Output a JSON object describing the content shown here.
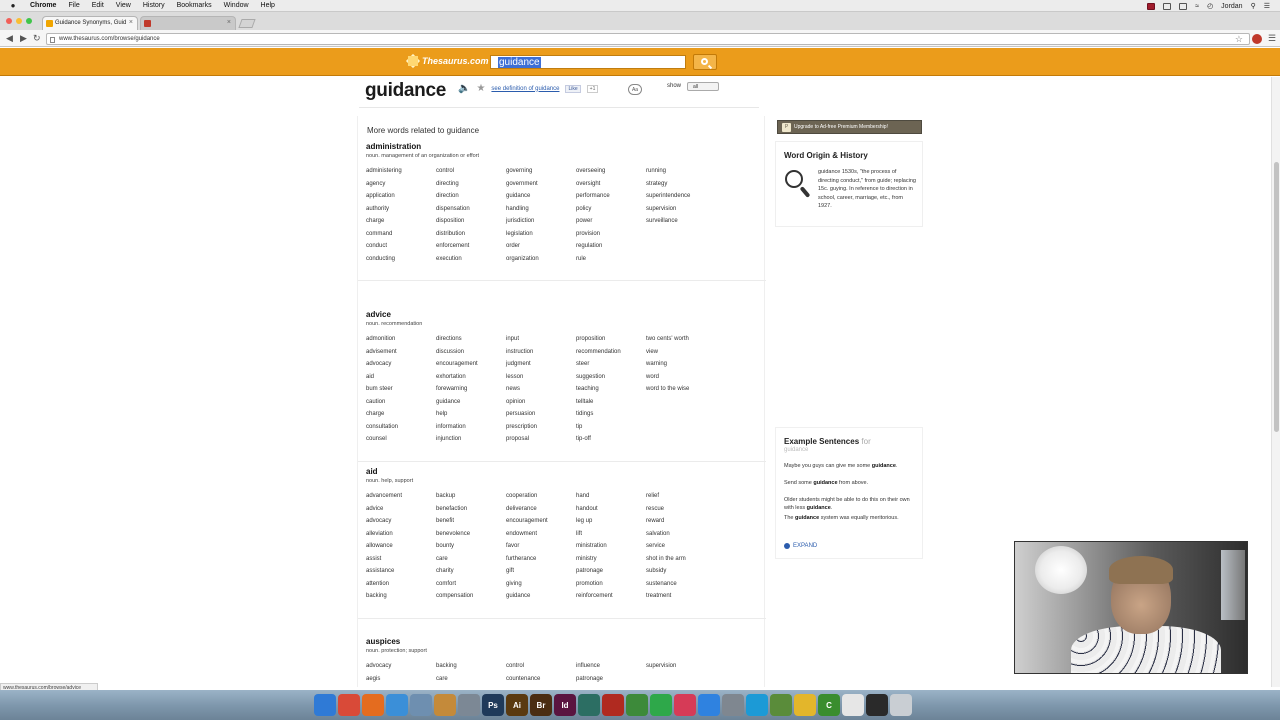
{
  "menubar": {
    "apple": "",
    "items": [
      "Chrome",
      "File",
      "Edit",
      "View",
      "History",
      "Bookmarks",
      "Window",
      "Help"
    ],
    "user": "Jordan"
  },
  "tabs": [
    {
      "title": "Guidance Synonyms, Guid",
      "active": true,
      "favicon_color": "#f0a500"
    },
    {
      "title": "",
      "active": false,
      "favicon_color": "#c0392b"
    }
  ],
  "address": {
    "url": "www.thesaurus.com/browse/guidance"
  },
  "site": {
    "logo": "Thesaurus.com",
    "search_value": "guidance"
  },
  "entry": {
    "headword": "guidance",
    "see_definition": "see definition of guidance",
    "like": "Like",
    "gplus": "+1",
    "aa": "Aa",
    "show_label": "show",
    "show_value": "all",
    "related_heading": "More words related to guidance"
  },
  "sections": [
    {
      "title": "administration",
      "definition": "noun. management of an organization or effort",
      "columns": [
        [
          "administering",
          "agency",
          "application",
          "authority",
          "charge",
          "command",
          "conduct",
          "conducting"
        ],
        [
          "control",
          "directing",
          "direction",
          "dispensation",
          "disposition",
          "distribution",
          "enforcement",
          "execution"
        ],
        [
          "governing",
          "government",
          "guidance",
          "handling",
          "jurisdiction",
          "legislation",
          "order",
          "organization"
        ],
        [
          "overseeing",
          "oversight",
          "performance",
          "policy",
          "power",
          "provision",
          "regulation",
          "rule"
        ],
        [
          "running",
          "strategy",
          "superintendence",
          "supervision",
          "surveillance"
        ]
      ]
    },
    {
      "title": "advice",
      "definition": "noun. recommendation",
      "columns": [
        [
          "admonition",
          "advisement",
          "advocacy",
          "aid",
          "bum steer",
          "caution",
          "charge",
          "consultation",
          "counsel"
        ],
        [
          "directions",
          "discussion",
          "encouragement",
          "exhortation",
          "forewarning",
          "guidance",
          "help",
          "information",
          "injunction"
        ],
        [
          "input",
          "instruction",
          "judgment",
          "lesson",
          "news",
          "opinion",
          "persuasion",
          "prescription",
          "proposal"
        ],
        [
          "proposition",
          "recommendation",
          "steer",
          "suggestion",
          "teaching",
          "telltale",
          "tidings",
          "tip",
          "tip-off"
        ],
        [
          "two cents' worth",
          "view",
          "warning",
          "word",
          "word to the wise"
        ]
      ]
    },
    {
      "title": "aid",
      "definition": "noun. help, support",
      "columns": [
        [
          "advancement",
          "advice",
          "advocacy",
          "alleviation",
          "allowance",
          "assist",
          "assistance",
          "attention",
          "backing"
        ],
        [
          "backup",
          "benefaction",
          "benefit",
          "benevolence",
          "bounty",
          "care",
          "charity",
          "comfort",
          "compensation"
        ],
        [
          "cooperation",
          "deliverance",
          "encouragement",
          "endowment",
          "favor",
          "furtherance",
          "gift",
          "giving",
          "guidance"
        ],
        [
          "hand",
          "handout",
          "leg up",
          "lift",
          "ministration",
          "ministry",
          "patronage",
          "promotion",
          "reinforcement"
        ],
        [
          "relief",
          "rescue",
          "reward",
          "salvation",
          "service",
          "shot in the arm",
          "subsidy",
          "sustenance",
          "treatment"
        ]
      ]
    },
    {
      "title": "auspices",
      "definition": "noun. protection; support",
      "columns": [
        [
          "advocacy",
          "aegis"
        ],
        [
          "backing",
          "care"
        ],
        [
          "control",
          "countenance"
        ],
        [
          "influence",
          "patronage"
        ],
        [
          "supervision"
        ]
      ]
    }
  ],
  "sidebar": {
    "upgrade": "Upgrade to Ad-free Premium Membership!",
    "upgrade_badge": "P",
    "origin_title": "Word Origin & History",
    "origin_word": "guidance",
    "origin_text": "1530s, \"the process of directing conduct,\" from guide; replacing 15c. guying. In reference to direction in school, career, marriage, etc., from 1927.",
    "examples_title": "Example Sentences",
    "examples_for": "for",
    "examples_word": "guidance",
    "sentences": [
      {
        "before": "Maybe you guys can give me some ",
        "bold": "guidance",
        "after": "."
      },
      {
        "before": "Send some ",
        "bold": "guidance",
        "after": " from above."
      },
      {
        "before": "Older students might be able to do this on their own with less ",
        "bold": "guidance",
        "after": "."
      },
      {
        "before": "The ",
        "bold": "guidance",
        "after": " system was equally meritorious."
      }
    ],
    "expand": "EXPAND"
  },
  "statusbar": {
    "text": "www.thesaurus.com/browse/advice"
  },
  "dock": {
    "icons": [
      {
        "name": "finder-icon",
        "label": "",
        "color": "#2f7ad6"
      },
      {
        "name": "chrome-icon",
        "label": "",
        "color": "#d94a38"
      },
      {
        "name": "firefox-icon",
        "label": "",
        "color": "#e46c1f"
      },
      {
        "name": "safari-icon",
        "label": "",
        "color": "#3b8fd8"
      },
      {
        "name": "preview-icon",
        "label": "",
        "color": "#6e8fb0"
      },
      {
        "name": "transmit-icon",
        "label": "",
        "color": "#c48a3a"
      },
      {
        "name": "package-icon",
        "label": "",
        "color": "#7c8895"
      },
      {
        "name": "photoshop-icon",
        "label": "Ps",
        "color": "#1f3a5a"
      },
      {
        "name": "illustrator-icon",
        "label": "Ai",
        "color": "#5a3a10"
      },
      {
        "name": "bridge-icon",
        "label": "Br",
        "color": "#4a2d12"
      },
      {
        "name": "indesign-icon",
        "label": "Id",
        "color": "#5a1440"
      },
      {
        "name": "dreamweaver-icon",
        "label": "",
        "color": "#2c6e63"
      },
      {
        "name": "filezilla-icon",
        "label": "",
        "color": "#b02a20"
      },
      {
        "name": "textwrangler-icon",
        "label": "",
        "color": "#3d8a3a"
      },
      {
        "name": "messages-icon",
        "label": "",
        "color": "#2ea84a"
      },
      {
        "name": "itunes-icon",
        "label": "",
        "color": "#d63b57"
      },
      {
        "name": "app-store-icon",
        "label": "",
        "color": "#2f82e0"
      },
      {
        "name": "system-prefs-icon",
        "label": "",
        "color": "#7f8790"
      },
      {
        "name": "skype-icon",
        "label": "",
        "color": "#1c9ad6"
      },
      {
        "name": "spotify-icon",
        "label": "",
        "color": "#5a8c3a"
      },
      {
        "name": "adium-icon",
        "label": "",
        "color": "#e3b62b"
      },
      {
        "name": "coda-icon",
        "label": "C",
        "color": "#3a8d2e"
      },
      {
        "name": "document-icon",
        "label": "",
        "color": "#e6e6e6"
      },
      {
        "name": "terminal-icon",
        "label": "",
        "color": "#2a2a2a"
      },
      {
        "name": "trash-icon",
        "label": "",
        "color": "#c9ced3"
      }
    ]
  }
}
